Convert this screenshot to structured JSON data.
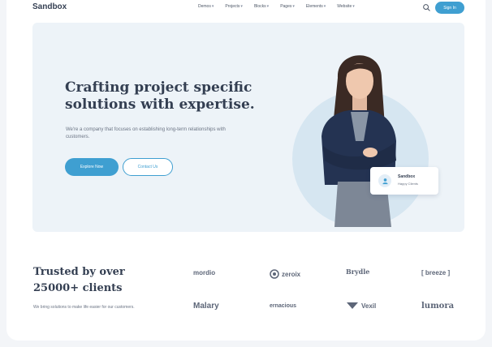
{
  "header": {
    "logo": "Sandbox",
    "nav": [
      {
        "label": "Demos",
        "chevron": "▾"
      },
      {
        "label": "Projects",
        "chevron": "▾"
      },
      {
        "label": "Blocks",
        "chevron": "▾"
      },
      {
        "label": "Pages",
        "chevron": "▾"
      },
      {
        "label": "Elements",
        "chevron": "▾"
      },
      {
        "label": "Website",
        "chevron": "▾"
      }
    ],
    "search_icon": "search-icon",
    "signin_label": "Sign In"
  },
  "hero": {
    "title": "Crafting project specific solutions with expertise.",
    "text": "We're a company that focuses on establishing long-term relationships with customers.",
    "primary_button": "Explore Now",
    "secondary_button": "Contact Us",
    "card": {
      "title": "Sandbox",
      "subtitle": "Happy Clients",
      "icon": "user-icon"
    }
  },
  "clients": {
    "title": "Trusted by over 25000+ clients",
    "text": "We bring solutions to make life easier for our customers.",
    "logos": [
      "mordio",
      "zeroix",
      "Brydle",
      "[ breeze ]",
      "Malary",
      "ernacious",
      "Vexil",
      "lumora"
    ]
  },
  "colors": {
    "accent": "#3f9fd1",
    "hero_bg": "#edf3f8",
    "heading": "#343f52"
  }
}
